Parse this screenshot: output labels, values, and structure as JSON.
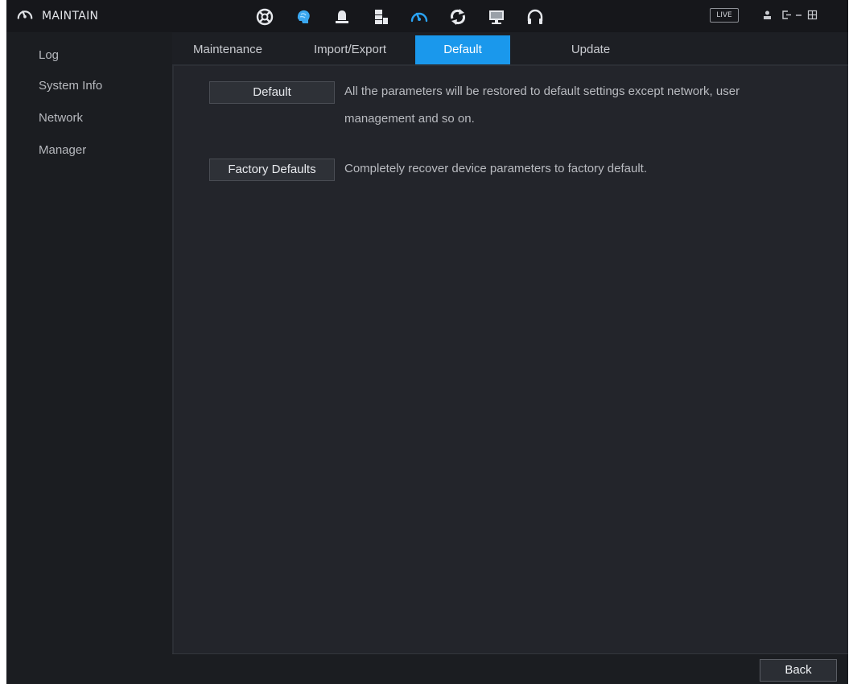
{
  "header": {
    "title": "MAINTAIN",
    "icon": "gauge-icon",
    "live_label": "LIVE",
    "nav_icons": [
      "search-icon",
      "ai-head-icon",
      "alarm-bell-icon",
      "storage-icon",
      "maintain-gauge-icon",
      "backup-icon",
      "display-icon",
      "audio-icon"
    ],
    "active_nav_icon": "maintain-gauge-icon"
  },
  "sidebar": {
    "items": [
      {
        "label": "Log"
      },
      {
        "label": "System Info"
      },
      {
        "label": "Network"
      },
      {
        "label": "Manager"
      }
    ]
  },
  "tabs": [
    {
      "label": "Maintenance",
      "active": false
    },
    {
      "label": "Import/Export",
      "active": false
    },
    {
      "label": "Default",
      "active": true
    },
    {
      "label": "Update",
      "active": false
    }
  ],
  "content": {
    "default_button": "Default",
    "default_description_line1": "All the parameters will be restored to default settings except network, user",
    "default_description_line2": "management and so on.",
    "factory_button": "Factory Defaults",
    "factory_description": "Completely recover device parameters to factory default."
  },
  "footer": {
    "back_label": "Back"
  },
  "colors": {
    "accent": "#1a98ec",
    "background": "#1d1f24"
  }
}
